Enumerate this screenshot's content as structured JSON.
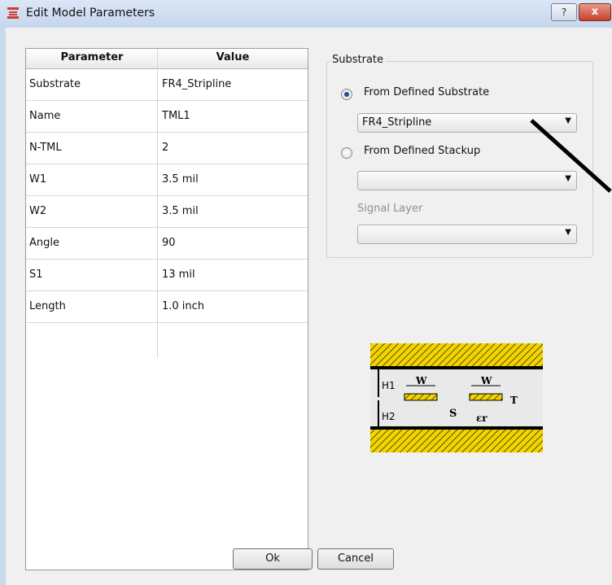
{
  "window": {
    "title": "Edit Model Parameters",
    "help_label": "?",
    "close_label": "x"
  },
  "table": {
    "headers": [
      "Parameter",
      "Value"
    ],
    "rows": [
      {
        "param": "Substrate",
        "value": "FR4_Stripline"
      },
      {
        "param": "Name",
        "value": "TML1"
      },
      {
        "param": "N-TML",
        "value": "2"
      },
      {
        "param": "W1",
        "value": "3.5 mil"
      },
      {
        "param": "W2",
        "value": "3.5 mil"
      },
      {
        "param": "Angle",
        "value": "90"
      },
      {
        "param": "S1",
        "value": "13 mil"
      },
      {
        "param": "Length",
        "value": "1.0 inch"
      }
    ]
  },
  "substrate": {
    "group_title": "Substrate",
    "from_defined_substrate": "From Defined Substrate",
    "from_defined_substrate_selected": true,
    "substrate_value": "FR4_Stripline",
    "from_defined_stackup": "From Defined Stackup",
    "from_defined_stackup_selected": false,
    "stackup_value": "",
    "signal_layer_label": "Signal Layer",
    "signal_layer_value": ""
  },
  "diagram": {
    "labels": {
      "h1": "H1",
      "h2": "H2",
      "w1": "W",
      "w2": "W",
      "s": "S",
      "t": "T",
      "er": "εr"
    }
  },
  "buttons": {
    "ok": "Ok",
    "cancel": "Cancel"
  },
  "colors": {
    "title_bg": "#c9d9ee",
    "close_red": "#c6402b",
    "substrate_yellow": "#f2d400",
    "radio_selected": "#1b4f8f"
  },
  "icons": {
    "window": "stack-layers-icon",
    "combo_arrow": "triangle-down-icon"
  }
}
